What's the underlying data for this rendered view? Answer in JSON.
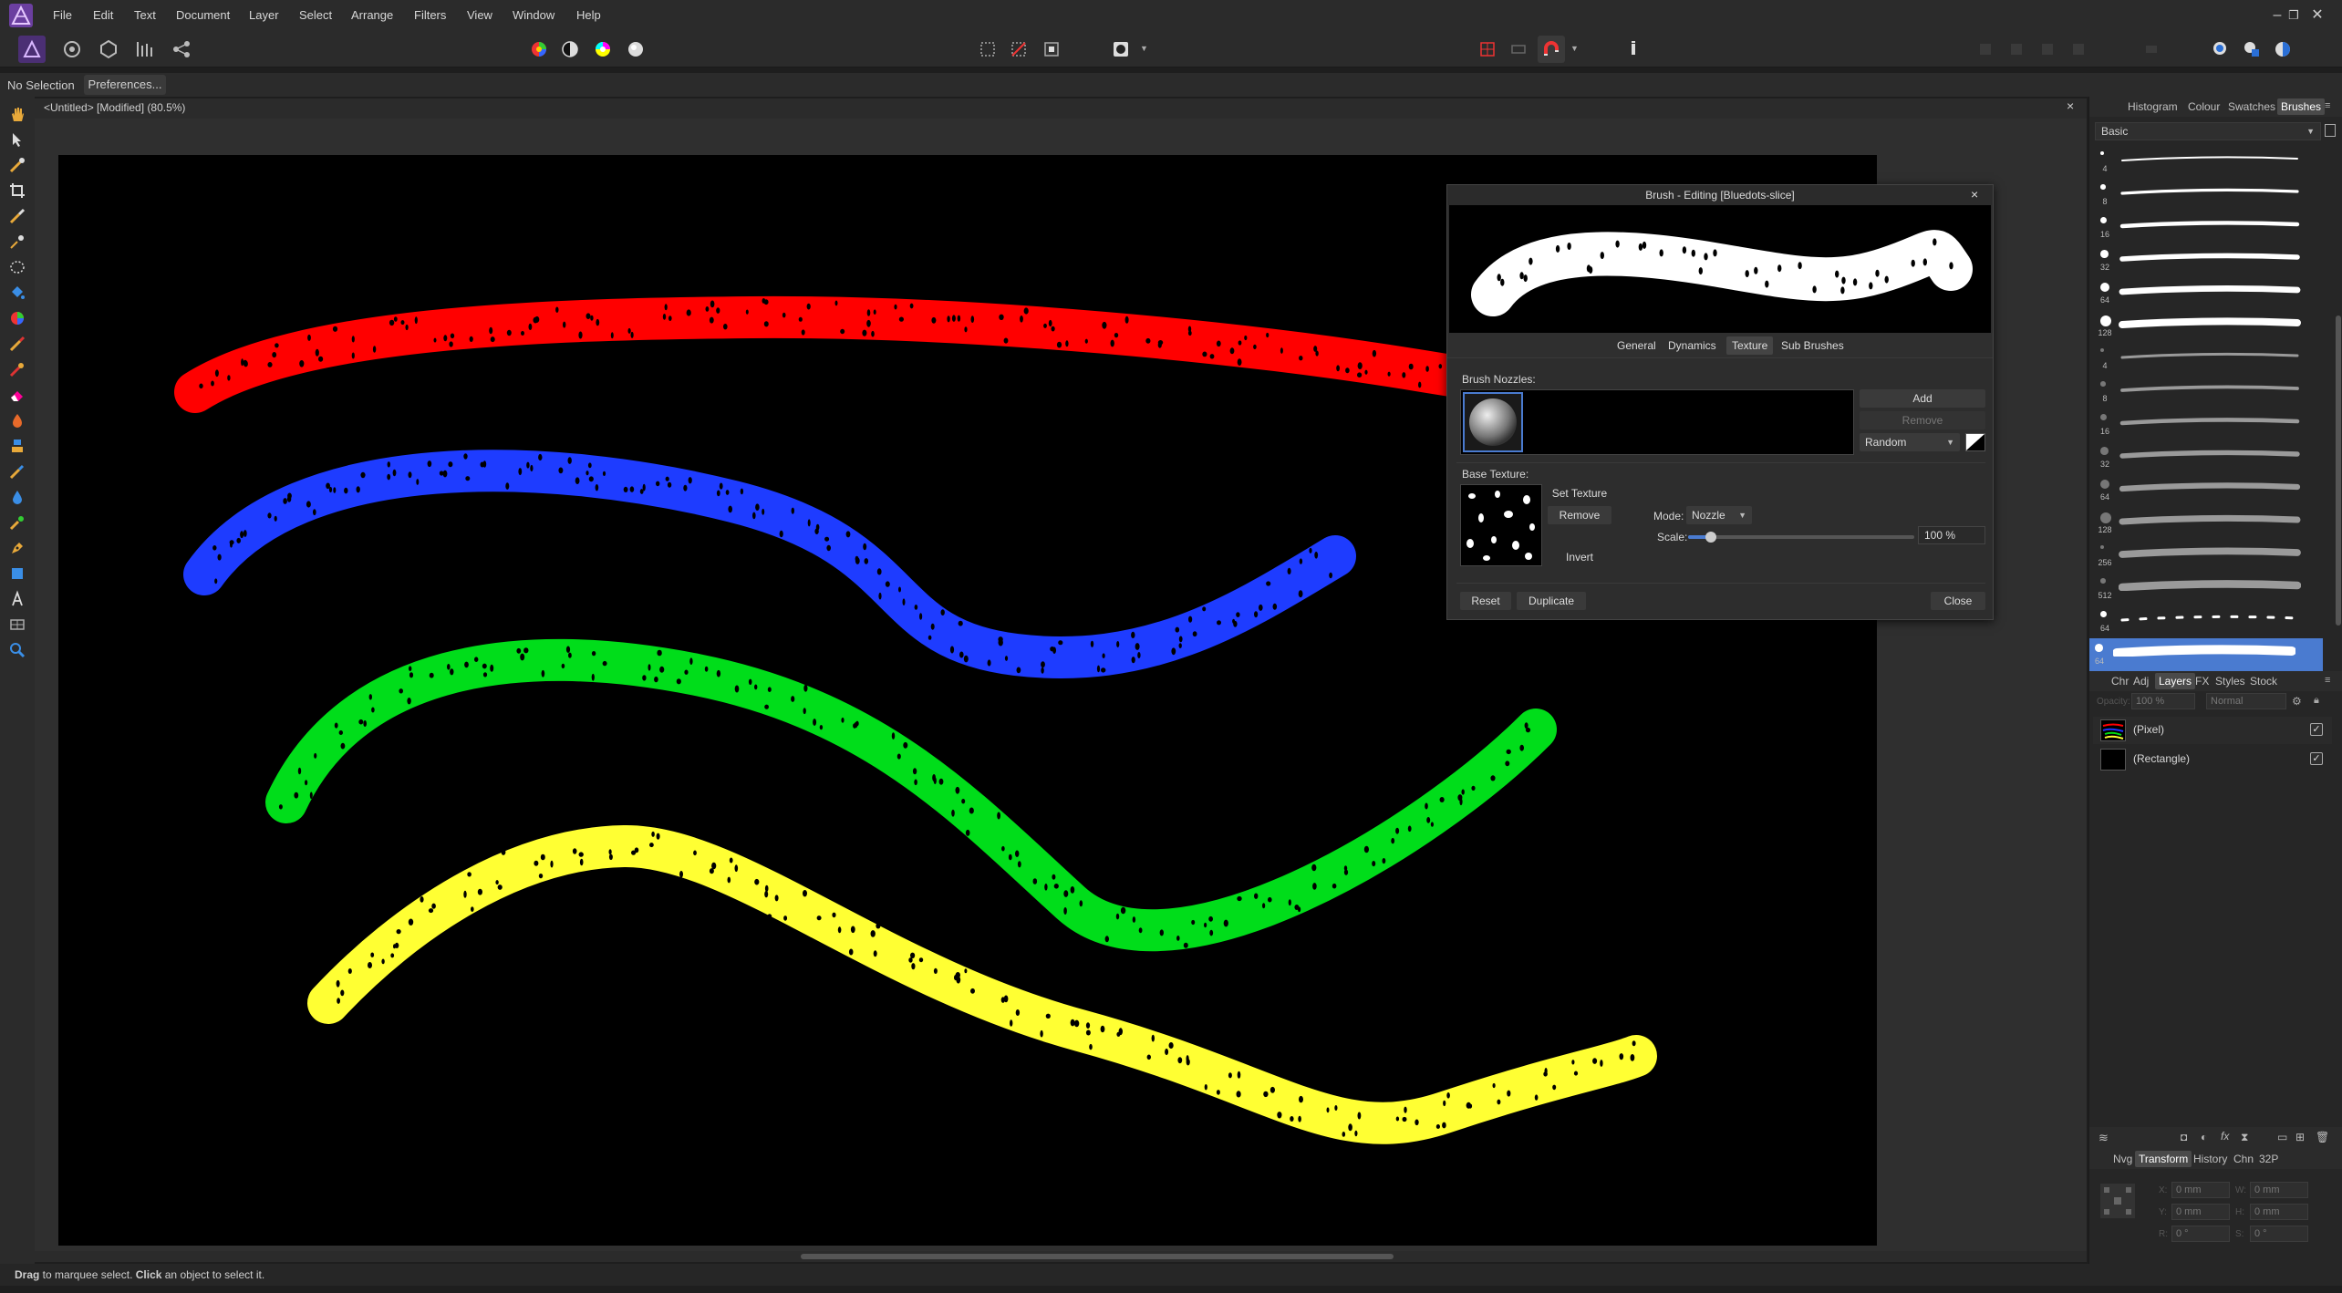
{
  "menu": {
    "items": [
      "File",
      "Edit",
      "Text",
      "Document",
      "Layer",
      "Select",
      "Arrange",
      "Filters",
      "View",
      "Window",
      "Help"
    ]
  },
  "context": {
    "selection": "No Selection",
    "preferences_label": "Preferences..."
  },
  "document": {
    "title": "<Untitled> [Modified] (80.5%)",
    "close_glyph": "×"
  },
  "brush_dialog": {
    "title": "Brush - Editing [Bluedots-slice]",
    "close_glyph": "×",
    "tabs": [
      "General",
      "Dynamics",
      "Texture",
      "Sub Brushes"
    ],
    "active_tab": "Texture",
    "brush_nozzles_label": "Brush Nozzles:",
    "add_label": "Add",
    "remove_nozzle_label": "Remove",
    "order_value": "Random",
    "base_texture_label": "Base Texture:",
    "set_texture_label": "Set Texture",
    "remove_texture_label": "Remove",
    "invert_label": "Invert",
    "mode_label": "Mode:",
    "mode_value": "Nozzle",
    "scale_label": "Scale:",
    "scale_value": "100 %",
    "scale_fraction": 0.1,
    "reset_label": "Reset",
    "duplicate_label": "Duplicate",
    "close_label": "Close"
  },
  "top_panel": {
    "tabs": [
      "Histogram",
      "Colour",
      "Swatches",
      "Brushes"
    ],
    "active": "Brushes",
    "category": "Basic",
    "brush_sizes": [
      "4",
      "8",
      "16",
      "32",
      "64",
      "128",
      "4",
      "8",
      "16",
      "32",
      "64",
      "128",
      "256",
      "512",
      "64",
      "64"
    ]
  },
  "layers_panel": {
    "tabs": [
      "Chr",
      "Adj",
      "Layers",
      "FX",
      "Styles",
      "Stock"
    ],
    "active": "Layers",
    "opacity_label": "Opacity:",
    "opacity_value": "100 %",
    "blend_mode": "Normal",
    "layers": [
      {
        "name": "(Pixel)",
        "checked": true
      },
      {
        "name": "(Rectangle)",
        "checked": true
      }
    ]
  },
  "transform_panel": {
    "tabs": [
      "Nvg",
      "Transform",
      "History",
      "Chn",
      "32P"
    ],
    "active": "Transform",
    "fields": [
      {
        "label": "X:",
        "value": "0 mm"
      },
      {
        "label": "W:",
        "value": "0 mm"
      },
      {
        "label": "Y:",
        "value": "0 mm"
      },
      {
        "label": "H:",
        "value": "0 mm"
      },
      {
        "label": "R:",
        "value": "0 °"
      },
      {
        "label": "S:",
        "value": "0 °"
      }
    ]
  },
  "status": {
    "drag": "Drag",
    "drag_text": " to marquee select. ",
    "click": "Click",
    "click_text": " an object to select it."
  },
  "colors": {
    "stroke_red": "#ff0000",
    "stroke_blue": "#1e3cff",
    "stroke_green": "#00dd1a",
    "stroke_yellow": "#ffff33",
    "accent": "#4a7bd0"
  }
}
